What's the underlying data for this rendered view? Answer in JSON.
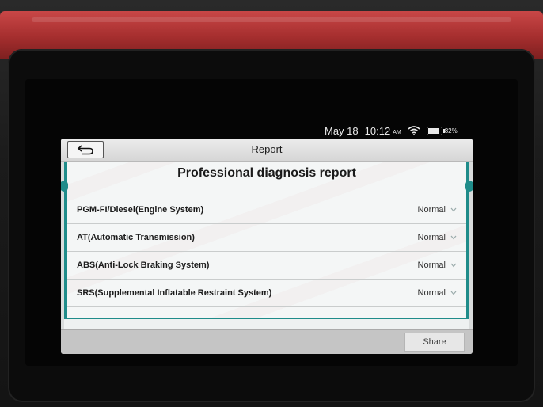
{
  "statusbar": {
    "date": "May 18",
    "time": "10:12",
    "ampm": "AM",
    "battery_pct": "82%",
    "battery_level": 0.82
  },
  "app": {
    "title": "Report",
    "report_heading": "Professional diagnosis report",
    "rows": [
      {
        "label": "PGM-FI/Diesel(Engine System)",
        "status": "Normal"
      },
      {
        "label": "AT(Automatic Transmission)",
        "status": "Normal"
      },
      {
        "label": "ABS(Anti-Lock Braking System)",
        "status": "Normal"
      },
      {
        "label": "SRS(Supplemental Inflatable Restraint System)",
        "status": "Normal"
      }
    ],
    "share_label": "Share"
  },
  "colors": {
    "accent": "#1f8c8a",
    "bumper": "#b33434"
  }
}
